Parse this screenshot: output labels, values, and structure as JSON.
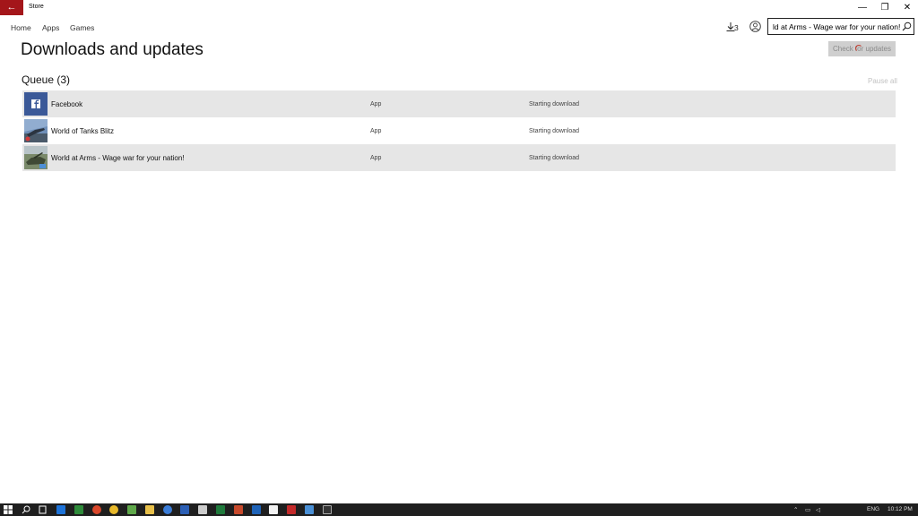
{
  "window": {
    "app_title": "Store",
    "back_glyph": "←",
    "minimize_glyph": "—",
    "maximize_glyph": "❐",
    "close_glyph": "✕"
  },
  "nav": {
    "home": "Home",
    "apps": "Apps",
    "games": "Games",
    "download_count": "3",
    "search_value": "ld at Arms - Wage war for your nation!"
  },
  "page": {
    "title": "Downloads and updates",
    "check_updates": "Check for updates",
    "queue_title": "Queue (3)",
    "pause_all": "Pause all"
  },
  "queue": [
    {
      "name": "Facebook",
      "type": "App",
      "status": "Starting download",
      "icon": "facebook-icon"
    },
    {
      "name": "World of Tanks Blitz",
      "type": "App",
      "status": "Starting download",
      "icon": "world-of-tanks-icon"
    },
    {
      "name": "World at Arms - Wage war for your nation!",
      "type": "App",
      "status": "Starting download",
      "icon": "world-at-arms-icon"
    }
  ],
  "taskbar": {
    "language": "ENG",
    "time": "10:12 PM"
  },
  "colors": {
    "accent": "#a4161a",
    "row_shade": "#e6e6e6",
    "taskbar": "#1f1f1f"
  }
}
